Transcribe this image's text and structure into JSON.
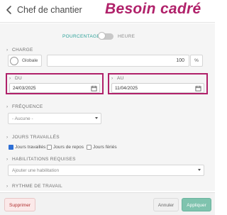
{
  "header": {
    "title": "Chef de chantier",
    "brand": "Besoin cadré",
    "back_icon": "arrow-left-icon"
  },
  "mode_toggle": {
    "left_label": "POURCENTAGE",
    "right_label": "HEURE",
    "state": "pourcentage"
  },
  "charge": {
    "label": "CHARGE",
    "radio_label": "Globale",
    "value": "100",
    "unit": "%"
  },
  "dates": {
    "du_label": "DU",
    "du_value": "24/03/2025",
    "au_label": "AU",
    "au_value": "11/04/2025",
    "highlight_color": "#b0216a",
    "calendar_icon": "calendar-icon"
  },
  "frequence": {
    "label": "FRÉQUENCE",
    "selected": "- Aucune -"
  },
  "jours": {
    "label": "JOURS TRAVAILLÉS",
    "options": [
      {
        "label": "Jours travaillés",
        "checked": true
      },
      {
        "label": "Jours de repos",
        "checked": false
      },
      {
        "label": "Jours fériés",
        "checked": false
      }
    ]
  },
  "habilitations": {
    "label": "HABILITATIONS REQUISES",
    "placeholder": "Ajouter une habilitation"
  },
  "rythme": {
    "label": "RYTHME DE TRAVAIL"
  },
  "footer": {
    "delete_label": "Supprimer",
    "cancel_label": "Annuler",
    "apply_label": "Appliquer"
  },
  "colors": {
    "accent": "#2aa198",
    "brand": "#b0216a",
    "apply": "#7fc3ae",
    "delete": "#b03030"
  }
}
